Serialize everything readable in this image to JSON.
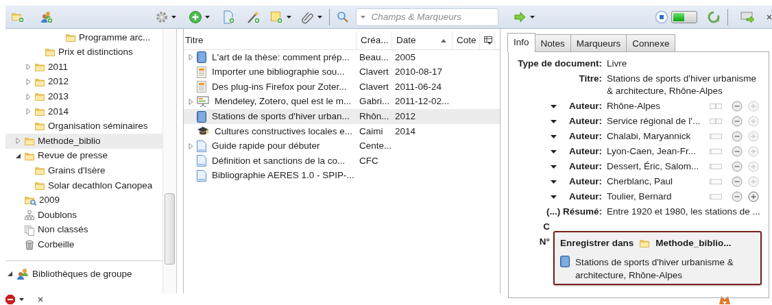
{
  "toolbar": {
    "search": {
      "placeholder": "Champs & Marqueurs"
    },
    "progress": {
      "level": 0.5
    }
  },
  "collections": [
    {
      "children": [
        {
          "children": [
            {
              "children": [
                {
                  "children": [
                    {
                      "label": "Programme arc...",
                      "kind": "folder",
                      "selected": false
                    }
                  ]
                }
              ]
            },
            {
              "label": "Prix et distinctions",
              "kind": "folder",
              "selected": false
            }
          ]
        },
        {
          "label": "2011",
          "kind": "folder",
          "expanded": false,
          "selected": false
        },
        {
          "label": "2012",
          "kind": "folder",
          "expanded": false,
          "selected": false
        },
        {
          "label": "2013",
          "kind": "folder",
          "expanded": false,
          "selected": false
        },
        {
          "label": "2014",
          "kind": "folder",
          "expanded": false,
          "selected": false
        },
        {
          "label": "Organisation séminaires",
          "kind": "folder",
          "selected": false
        }
      ]
    },
    {
      "label": "Methode_biblio",
      "kind": "folder",
      "expanded": false,
      "selected": true
    },
    {
      "label": "Revue de presse",
      "kind": "folder",
      "expanded": true,
      "selected": false,
      "children": [
        {
          "label": "Grains d'Isère",
          "kind": "folder",
          "selected": false
        },
        {
          "label": "Solar decathlon Canopea",
          "kind": "folder",
          "selected": false
        }
      ]
    },
    {
      "label": "2009",
      "kind": "search",
      "selected": false
    },
    {
      "label": "Doublons",
      "kind": "duplicates",
      "selected": false
    },
    {
      "label": "Non classés",
      "kind": "unfiled",
      "selected": false
    },
    {
      "label": "Corbeille",
      "kind": "trash",
      "selected": false
    }
  ],
  "group_libraries": {
    "label": "Bibliothèques de groupe",
    "expanded": true
  },
  "items": {
    "columns": [
      {
        "label": "Titre"
      },
      {
        "label": "Créa..."
      },
      {
        "label": "Date",
        "sort_ascending": true
      },
      {
        "label": "Cote"
      }
    ],
    "rows": [
      {
        "kind": "book",
        "expanded": false,
        "title": "L'art de la thèse: comment prép...",
        "creator": "Beau...",
        "date": "2005",
        "selected": false
      },
      {
        "kind": "webpage",
        "title": "Importer une bibliographie sou...",
        "creator": "Clavert",
        "date": "2010-08-17",
        "selected": false
      },
      {
        "kind": "webpage",
        "title": "Des plug-ins Firefox pour Zoter...",
        "creator": "Clavert",
        "date": "2011-06-24",
        "selected": false
      },
      {
        "kind": "presentation",
        "expanded": false,
        "title": "Mendeley, Zotero, quel est le m...",
        "creator": "Gabri...",
        "date": "2011-12-02...",
        "selected": false
      },
      {
        "kind": "book",
        "title": "Stations de sports d'hiver urban...",
        "creator": "Rhôn...",
        "date": "2012",
        "selected": true
      },
      {
        "kind": "thesis",
        "title": "Cultures constructives locales e...",
        "creator": "Caimi",
        "date": "2014",
        "selected": false
      },
      {
        "kind": "document",
        "expanded": false,
        "title": "Guide rapide pour débuter",
        "creator": "Cente...",
        "selected": false
      },
      {
        "kind": "document",
        "title": "Définition et sanctions de la co...",
        "creator": "CFC",
        "selected": false
      },
      {
        "kind": "document",
        "title": "Bibliographie AERES 1.0 - SPIP-...",
        "selected": false
      }
    ]
  },
  "item_pane": {
    "tabs": [
      {
        "label": "Info",
        "selected": true
      },
      {
        "label": "Notes",
        "selected": false
      },
      {
        "label": "Marqueurs",
        "selected": false
      },
      {
        "label": "Connexe",
        "selected": false
      }
    ],
    "fields": [
      {
        "kind": "plain",
        "label": "Type de document:",
        "value": "Livre"
      },
      {
        "kind": "plain",
        "label": "Titre:",
        "value": "Stations de sports d'hiver urbanisme & architecture, Rhône-Alpes"
      },
      {
        "kind": "creator",
        "label": "Auteur:",
        "value": "Rhône-Alpes",
        "single_field": true,
        "plus_enabled": false
      },
      {
        "kind": "creator",
        "label": "Auteur:",
        "value": "Service régional de l'...",
        "single_field": true,
        "plus_enabled": false
      },
      {
        "kind": "creator",
        "label": "Auteur:",
        "value": "Chalabi, Maryannick",
        "single_field": false,
        "plus_enabled": false
      },
      {
        "kind": "creator",
        "label": "Auteur:",
        "value": "Lyon-Caen, Jean-Fr...",
        "single_field": false,
        "plus_enabled": false
      },
      {
        "kind": "creator",
        "label": "Auteur:",
        "value": "Dessert, Éric, Salom...",
        "single_field": false,
        "plus_enabled": false
      },
      {
        "kind": "creator",
        "label": "Auteur:",
        "value": "Cherblanc, Paul",
        "single_field": false,
        "plus_enabled": false
      },
      {
        "kind": "creator",
        "label": "Auteur:",
        "value": "Toulier, Bernard",
        "single_field": false,
        "plus_enabled": true
      },
      {
        "kind": "plain",
        "label": "(...) Résumé:",
        "value": "Entre 1920 et 1980, les stations de ..."
      },
      {
        "kind": "partial",
        "label": "C"
      },
      {
        "kind": "partial",
        "label": "N°"
      }
    ]
  },
  "save_popup": {
    "heading": "Enregistrer dans",
    "target": "Methode_biblio...",
    "item_title": "Stations de sports d'hiver urbanisme & architecture, Rhône-Alpes"
  }
}
